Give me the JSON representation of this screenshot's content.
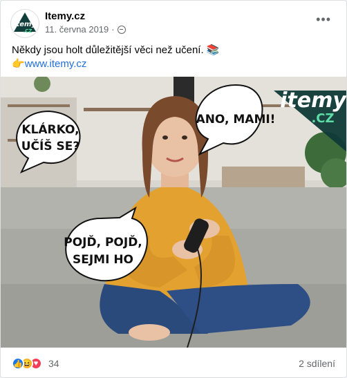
{
  "post": {
    "page_name": "Itemy.cz",
    "date": "11. června 2019",
    "separator": "·",
    "more": "•••",
    "text_line1": "Někdy jsou holt důležitější věci než učení. 📚",
    "pointer": "👉",
    "link": "www.itemy.cz"
  },
  "image": {
    "logo_main": "itemy",
    "logo_sub": ".CZ",
    "bubble_left_line1": "KLÁRKO,",
    "bubble_left_line2": "UČÍŠ SE?",
    "bubble_right": "ANO, MAMI!",
    "bubble_bottom_line1": "POJĎ, POJĎ,",
    "bubble_bottom_line2": "SEJMI HO"
  },
  "footer": {
    "reaction_count": "34",
    "shares": "2 sdílení"
  },
  "icons": {
    "like": "like-reaction-icon",
    "haha": "haha-reaction-icon",
    "love": "love-reaction-icon",
    "privacy": "globe-icon"
  },
  "colors": {
    "link": "#216fdb",
    "like": "#1877f2",
    "love": "#f33e58",
    "haha": "#f7b125",
    "logo_accent": "#5ddca5"
  }
}
